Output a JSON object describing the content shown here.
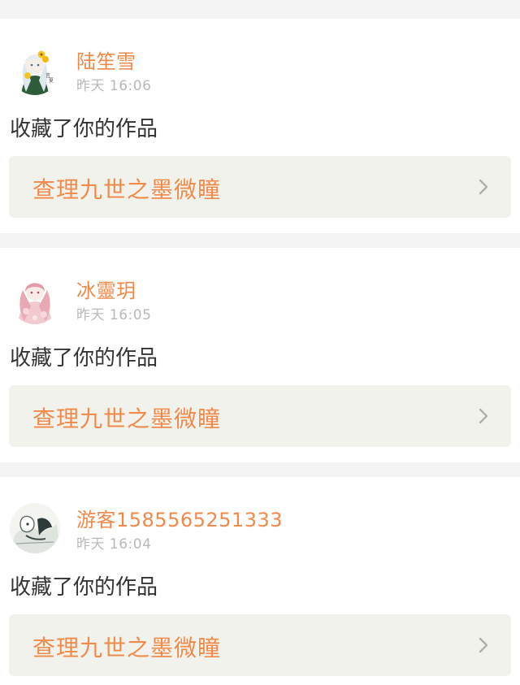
{
  "notifications": [
    {
      "username": "陆笙雪",
      "time": "昨天 16:06",
      "action": "收藏了你的作品",
      "work_title": "查理九世之墨微瞳",
      "avatar_icon": "anime-girl-flowers-avatar"
    },
    {
      "username": "冰靈玥",
      "time": "昨天 16:05",
      "action": "收藏了你的作品",
      "work_title": "查理九世之墨微瞳",
      "avatar_icon": "anime-girl-pink-avatar"
    },
    {
      "username": "游客1585565251333",
      "time": "昨天 16:04",
      "action": "收藏了你的作品",
      "work_title": "查理九世之墨微瞳",
      "avatar_icon": "anime-sketch-avatar"
    }
  ],
  "colors": {
    "accent": "#f08a4b",
    "time": "#b9b9b9",
    "text": "#333333",
    "work_bg": "#f2f2ec",
    "page_bg": "#f3f3f3",
    "chevron": "#b0b0b0"
  }
}
